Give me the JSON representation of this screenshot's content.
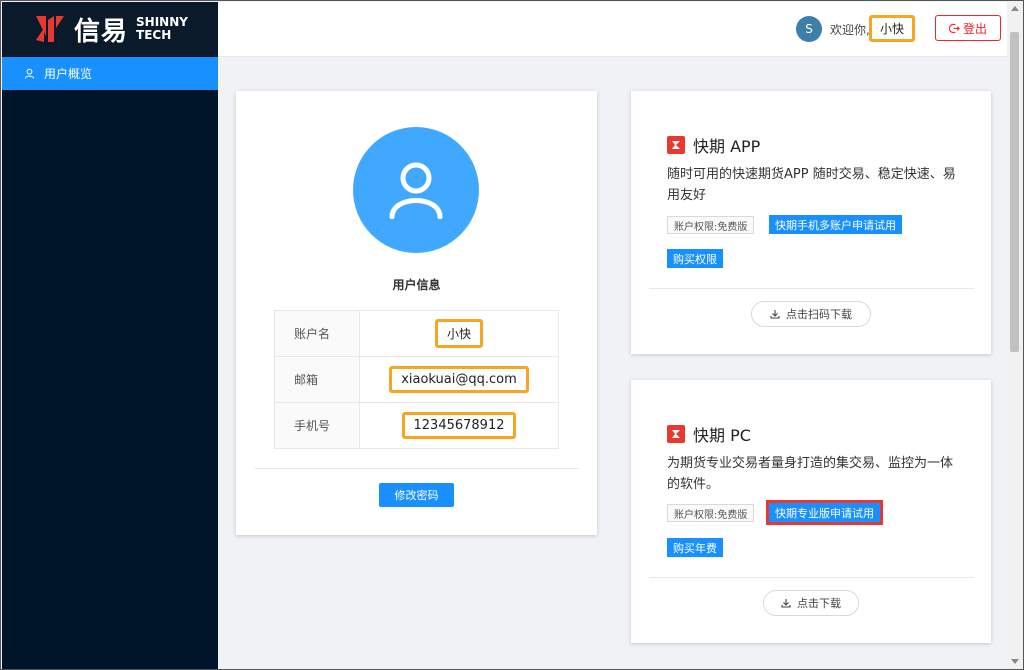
{
  "brand": {
    "cn": "信易",
    "en_line1": "SHINNY",
    "en_line2": "TECH"
  },
  "sidebar": {
    "items": [
      {
        "label": "用户概览"
      }
    ]
  },
  "header": {
    "avatar_letter": "S",
    "welcome": "欢迎你,",
    "username": "小快",
    "logout_label": "登出"
  },
  "user_card": {
    "title": "用户信息",
    "rows": [
      {
        "label": "账户名",
        "value": "小快"
      },
      {
        "label": "邮箱",
        "value": "xiaokuai@qq.com"
      },
      {
        "label": "手机号",
        "value": "12345678912"
      }
    ],
    "change_password_label": "修改密码"
  },
  "app_card": {
    "title": "快期 APP",
    "description": "随时可用的快速期货APP 随时交易、稳定快速、易用友好",
    "permission_tag": "账户权限:免费版",
    "trial_button": "快期手机多账户申请试用",
    "buy_button": "购买权限",
    "download_label": "点击扫码下载"
  },
  "pc_card": {
    "title": "快期 PC",
    "description": "为期货专业交易者量身打造的集交易、监控为一体的软件。",
    "permission_tag": "账户权限:免费版",
    "trial_button": "快期专业版申请试用",
    "buy_button": "购买年费",
    "download_label": "点击下载"
  },
  "colors": {
    "primary": "#1890ff",
    "sidebar_bg": "#001529",
    "highlight_orange": "#f5a623",
    "highlight_red": "#e53935",
    "logout_red": "#f5222d"
  }
}
